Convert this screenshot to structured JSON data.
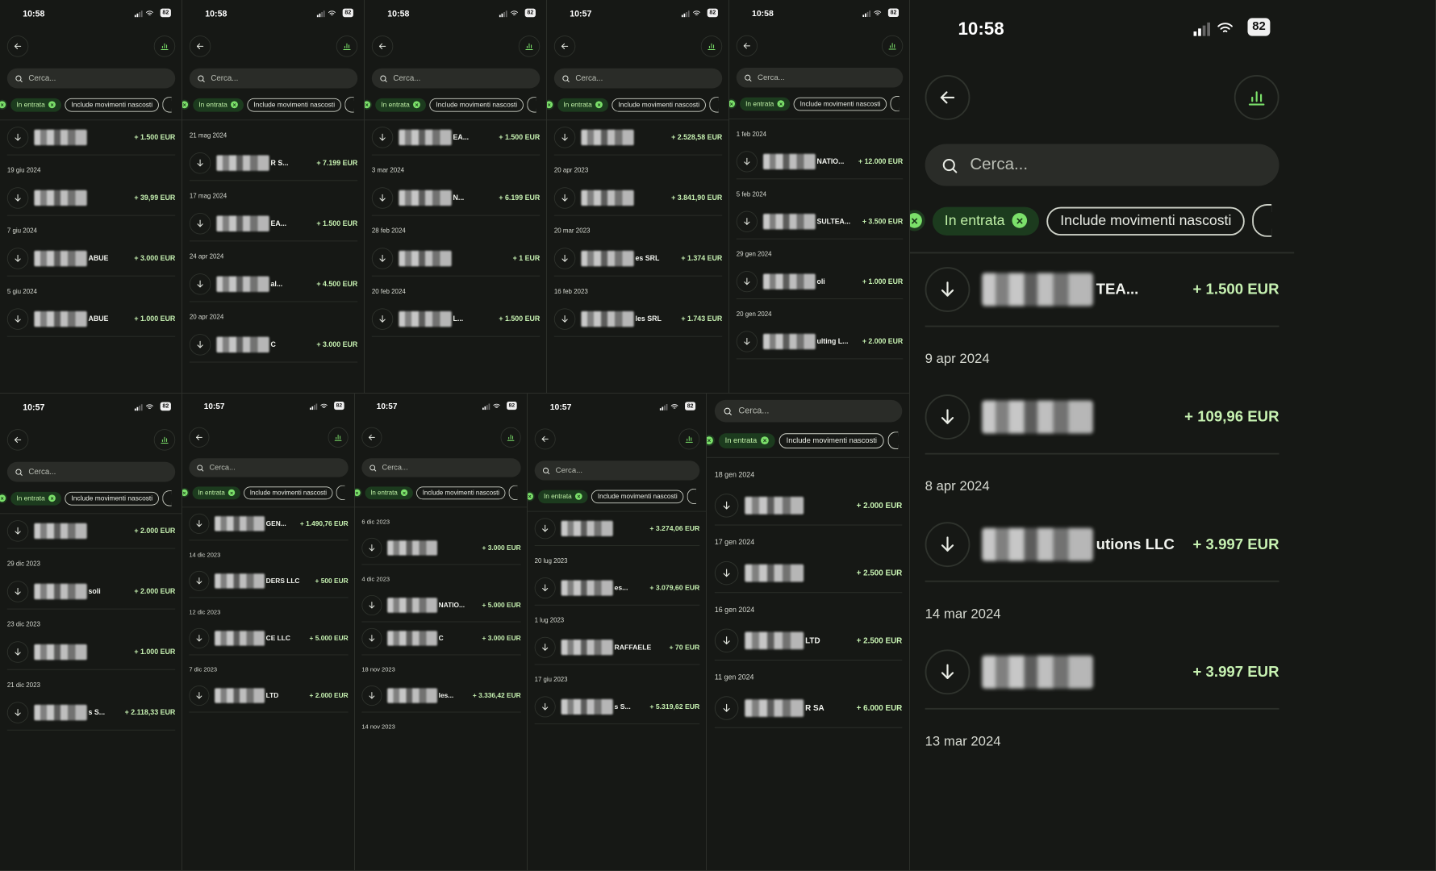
{
  "ui": {
    "search_placeholder": "Cerca...",
    "filter_incoming": "In entrata",
    "filter_hidden": "Include movimenti nascosti",
    "accent_color": "#7be06a",
    "amount_color": "#c7f2b2",
    "battery": "82"
  },
  "panels": [
    {
      "time": "10:58",
      "items": [
        {
          "date": "",
          "suffix": "",
          "amount": "+ 1.500 EUR"
        },
        {
          "date": "19 giu 2024",
          "suffix": "",
          "amount": "+ 39,99 EUR"
        },
        {
          "date": "7 giu 2024",
          "suffix": "ABUE",
          "amount": "+ 3.000 EUR"
        },
        {
          "date": "5 giu 2024",
          "suffix": "ABUE",
          "amount": "+ 1.000 EUR"
        }
      ]
    },
    {
      "time": "10:58",
      "items": [
        {
          "date": "21 mag 2024",
          "suffix": "R S...",
          "amount": "+ 7.199 EUR"
        },
        {
          "date": "17 mag 2024",
          "suffix": "EA...",
          "amount": "+ 1.500 EUR"
        },
        {
          "date": "24 apr 2024",
          "suffix": "al...",
          "amount": "+ 4.500 EUR"
        },
        {
          "date": "20 apr 2024",
          "suffix": "C",
          "amount": "+ 3.000 EUR"
        }
      ]
    },
    {
      "time": "10:58",
      "items": [
        {
          "date": "",
          "suffix": "EA...",
          "amount": "+ 1.500 EUR"
        },
        {
          "date": "3 mar 2024",
          "suffix": "N...",
          "amount": "+ 6.199 EUR"
        },
        {
          "date": "28 feb 2024",
          "suffix": "",
          "amount": "+ 1 EUR"
        },
        {
          "date": "20 feb 2024",
          "suffix": "L...",
          "amount": "+ 1.500 EUR"
        }
      ]
    },
    {
      "time": "10:57",
      "items": [
        {
          "date": "",
          "suffix": "",
          "amount": "+ 2.528,58 EUR"
        },
        {
          "date": "20 apr 2023",
          "suffix": "",
          "amount": "+ 3.841,90 EUR"
        },
        {
          "date": "20 mar 2023",
          "suffix": "es SRL",
          "amount": "+ 1.374 EUR"
        },
        {
          "date": "16 feb 2023",
          "suffix": "les SRL",
          "amount": "+ 1.743 EUR"
        }
      ]
    },
    {
      "time": "10:58",
      "items": [
        {
          "date": "1 feb 2024",
          "suffix": "NATIO...",
          "amount": "+ 12.000 EUR"
        },
        {
          "date": "5 feb 2024",
          "suffix": "SULTEA...",
          "amount": "+ 3.500 EUR"
        },
        {
          "date": "29 gen 2024",
          "suffix": "oli",
          "amount": "+ 1.000 EUR"
        },
        {
          "date": "20 gen 2024",
          "suffix": "ulting L...",
          "amount": "+ 2.000 EUR"
        }
      ]
    },
    {
      "time": "10:58",
      "items": [
        {
          "date": "",
          "suffix": "TEA...",
          "amount": "+ 1.500 EUR"
        },
        {
          "date": "9 apr 2024",
          "suffix": "",
          "amount": "+ 109,96 EUR"
        },
        {
          "date": "8 apr 2024",
          "suffix": "utions LLC",
          "amount": "+ 3.997 EUR"
        },
        {
          "date": "14 mar 2024",
          "suffix": "",
          "amount": "+ 3.997 EUR"
        },
        {
          "date": "13 mar 2024",
          "suffix": "",
          "amount": ""
        }
      ]
    },
    {
      "time": "10:57",
      "items": [
        {
          "date": "",
          "suffix": "",
          "amount": "+ 2.000 EUR"
        },
        {
          "date": "29 dic 2023",
          "suffix": "soli",
          "amount": "+ 2.000 EUR"
        },
        {
          "date": "23 dic 2023",
          "suffix": "",
          "amount": "+ 1.000 EUR"
        },
        {
          "date": "21 dic 2023",
          "suffix": "s S...",
          "amount": "+ 2.118,33 EUR"
        }
      ]
    },
    {
      "time": "10:57",
      "items": [
        {
          "date": "",
          "suffix": "GEN...",
          "amount": "+ 1.490,76 EUR"
        },
        {
          "date": "14 dic 2023",
          "suffix": "DERS LLC",
          "amount": "+ 500 EUR"
        },
        {
          "date": "12 dic 2023",
          "suffix": "CE LLC",
          "amount": "+ 5.000 EUR"
        },
        {
          "date": "7 dic 2023",
          "suffix": "LTD",
          "amount": "+ 2.000 EUR"
        }
      ]
    },
    {
      "time": "10:57",
      "items": [
        {
          "date": "6 dic 2023",
          "suffix": "",
          "amount": "+ 3.000 EUR"
        },
        {
          "date": "4 dic 2023",
          "suffix": "NATIO...",
          "amount": "+ 5.000 EUR"
        },
        {
          "date": "",
          "suffix": "C",
          "amount": "+ 3.000 EUR"
        },
        {
          "date": "18 nov 2023",
          "suffix": "les...",
          "amount": "+ 3.336,42 EUR"
        },
        {
          "date": "14 nov 2023",
          "suffix": "",
          "amount": ""
        }
      ]
    },
    {
      "time": "10:57",
      "items": [
        {
          "date": "",
          "suffix": "",
          "amount": "+ 3.274,06 EUR"
        },
        {
          "date": "20 lug 2023",
          "suffix": "es...",
          "amount": "+ 3.079,60 EUR"
        },
        {
          "date": "1 lug 2023",
          "suffix": "RAFFAELE",
          "amount": "+ 70 EUR"
        },
        {
          "date": "17 giu 2023",
          "suffix": "s S...",
          "amount": "+ 5.319,62 EUR"
        }
      ]
    },
    {
      "time": "",
      "items": [
        {
          "date": "18 gen 2024",
          "suffix": "",
          "amount": "+ 2.000 EUR"
        },
        {
          "date": "17 gen 2024",
          "suffix": "",
          "amount": "+ 2.500 EUR"
        },
        {
          "date": "16 gen 2024",
          "suffix": "LTD",
          "amount": "+ 2.500 EUR"
        },
        {
          "date": "11 gen 2024",
          "suffix": "R SA",
          "amount": "+ 6.000 EUR"
        }
      ]
    }
  ]
}
